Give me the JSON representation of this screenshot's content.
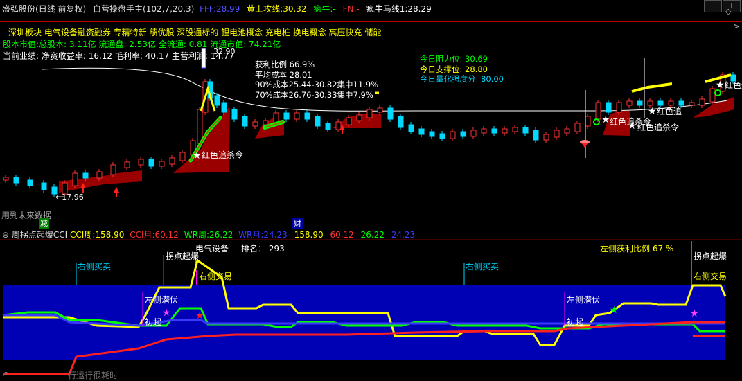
{
  "top_header": {
    "stock_name": "盛弘股份",
    "adjust": "(日线 前复权)",
    "indicator_name": "自营操盘手主",
    "params": "(102,7,20,3)",
    "fff_label": "FFF:",
    "fff_value": "28.99",
    "huangshang_label": "黄上攻线:",
    "huangshang_value": "30.32",
    "fengniu_label": "疯牛:",
    "fengniu_value": "-",
    "fn_label": "FN:",
    "fn_value": "-",
    "fnm_label": "疯牛马线1:",
    "fnm_value": "28.29"
  },
  "info_lines": {
    "concepts": "深圳板块  电气设备融资融券  专精特新  绩优股  深股通标的  锂电池概念  充电桩  换电概念  高压快充  储能",
    "capital_prefix": "股本市值:",
    "capital": "总股本: 3.11亿 流通盘: 2.53亿 全流通: 0.81  流通市值: 74.21亿",
    "performance": "当前业绩: 净资收益率: 16.12 毛利率: 40.17 主营利润: 14.77",
    "price_high": "32.90"
  },
  "chip_panel": {
    "profit_ratio": "获利比例 66.9%",
    "avg_cost": "平均成本 28.01",
    "cost90": "90%成本25.44-30.82集中11.9%",
    "cost70": "70%成本26.76-30.33集中7.9%"
  },
  "today_panel": {
    "resistance": "今日阻力位:   30.69",
    "support": "今日支撑位:   28.80",
    "strength": "今日量化强度分:   80.00"
  },
  "chart_labels": {
    "low_price": "17.96",
    "kill1": "红色追杀令",
    "kill2": "红色追杀令",
    "kill3": "红色追杀令",
    "kill4": "红色追",
    "kill5": "红色追杀令",
    "future": "用到未来数据",
    "bottom_tag1": "减",
    "bottom_tag2": "财"
  },
  "sub_header": {
    "name": "周拐点起爆CCI",
    "cciz_label": "CCI周:",
    "cciz": "158.90",
    "ccim_label": "CCI月:",
    "ccim": "60.12",
    "wrz_label": "WR周:",
    "wrz": "26.22",
    "wrm_label": "WR月:",
    "wrm": "24.23",
    "v1": "158.90",
    "v2": "60.12",
    "v3": "26.22",
    "v4": "24.23"
  },
  "sub_labels": {
    "sector": "电气设备",
    "rank": "排名：  293",
    "left_profit": "左侧获利比例 67 %",
    "right_buy1": "右侧买卖",
    "right_buy2": "右侧买卖",
    "inflect1": "拐点起爆",
    "inflect2": "拐点起爆",
    "right_trade1": "右侧交易",
    "right_trade2": "右侧交易",
    "left_hide1": "左侧潜伏",
    "left_hide2": "左侧潜伏",
    "start1": "初起",
    "start2": "初起",
    "bottom_note": "行运行很耗时"
  },
  "colors": {
    "up": "#ff3232",
    "down": "#00d8ff",
    "yellow": "#ffff00",
    "green": "#00ff00",
    "blue_band": "#0000b4",
    "frame": "#c00000"
  },
  "chart_data": {
    "type": "candlestick",
    "low_label": 17.96,
    "high_label": 32.9,
    "series": [
      {
        "name": "CCI周",
        "value": 158.9
      },
      {
        "name": "CCI月",
        "value": 60.12
      },
      {
        "name": "WR周",
        "value": 26.22
      },
      {
        "name": "WR月",
        "value": 24.23
      }
    ]
  }
}
